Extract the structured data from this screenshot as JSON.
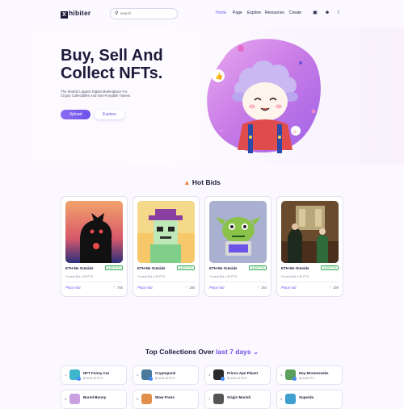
{
  "brand": {
    "logo_mark": "X",
    "logo_text": "hibiter"
  },
  "search": {
    "placeholder": "search"
  },
  "nav": {
    "items": [
      "Home",
      "Page",
      "Explore",
      "Resources",
      "Create"
    ],
    "active": "Home"
  },
  "hero": {
    "title_line1": "Buy, Sell And",
    "title_line2": "Collect NFTs.",
    "subtitle": "The Worlds Largest Digital Marketplace For Crypto Collectibles And Non-Fungible Tokens",
    "upload_label": "Upload",
    "explore_label": "Explore"
  },
  "hot_bids": {
    "title": "Hot Bids",
    "cards": [
      {
        "name": "ETH Me Outside",
        "price": "4.89 ETH",
        "bid_label": "Current Bid 1.00 ETH",
        "place_bid": "Place bid",
        "likes": "750"
      },
      {
        "name": "ETH Me Outside",
        "price": "4.89 ETH",
        "bid_label": "Current Bid 1.00 ETH",
        "place_bid": "Place bid",
        "likes": "180"
      },
      {
        "name": "ETH Me Outside",
        "price": "4.89 ETH",
        "bid_label": "Current Bid 1.00 ETH",
        "place_bid": "Place bid",
        "likes": "164"
      },
      {
        "name": "ETH Me Outside",
        "price": "4.89 ETH",
        "bid_label": "Current Bid 1.00 ETH",
        "place_bid": "Place bid",
        "likes": "159"
      }
    ]
  },
  "top_collections": {
    "title_prefix": "Top Collections Over",
    "title_highlight": "last 7 days",
    "items": [
      {
        "num": "1.",
        "name": "NFT Funny Cat",
        "value": "$3,618.36 ETH"
      },
      {
        "num": "2.",
        "name": "Cryptopunk",
        "value": "$3,618.36 ETH"
      },
      {
        "num": "3.",
        "name": "Prince Ape Planet",
        "value": "$3,618.36 ETH"
      },
      {
        "num": "4.",
        "name": "Hey Mrsmeseeks",
        "value": "$3,618 ETH"
      },
      {
        "num": "5.",
        "name": "Bored Bunny",
        "value": ""
      },
      {
        "num": "6.",
        "name": "Wow Frens",
        "value": ""
      },
      {
        "num": "7.",
        "name": "Origin Morish",
        "value": ""
      },
      {
        "num": "8.",
        "name": "Superdo",
        "value": ""
      }
    ]
  },
  "colors": {
    "accent": "#6c52e8",
    "success": "#2fa84f",
    "text": "#1c1a3a"
  }
}
